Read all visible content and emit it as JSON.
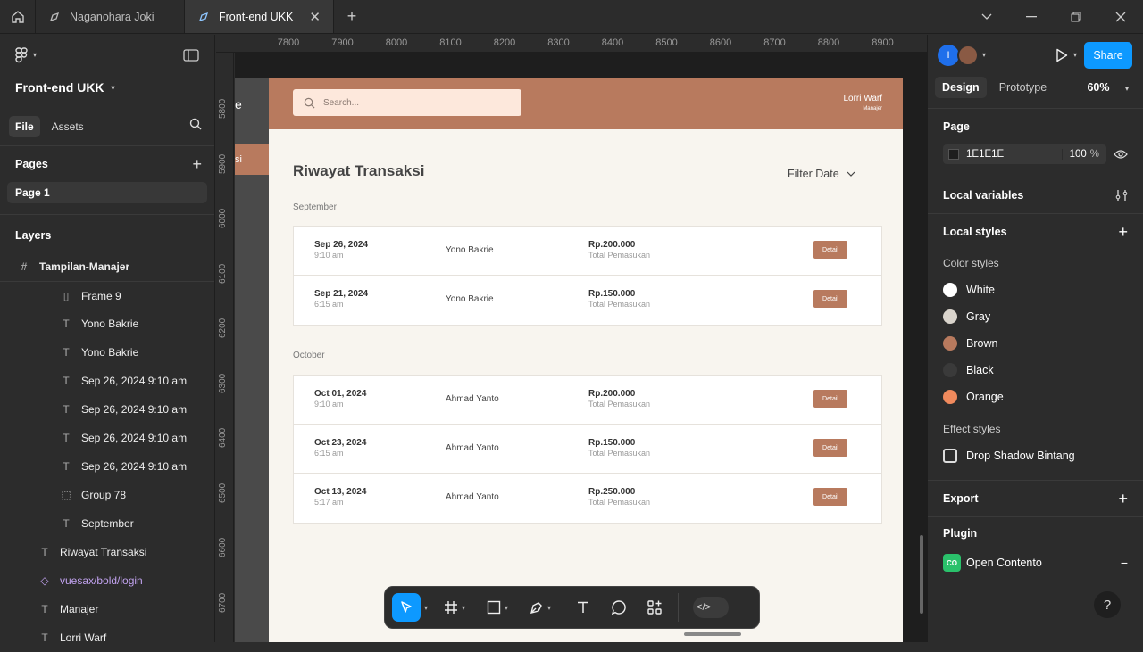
{
  "titlebar": {
    "tabs": [
      {
        "label": "Naganohara Joki"
      },
      {
        "label": "Front-end UKK"
      }
    ]
  },
  "left_panel": {
    "project_name": "Front-end UKK",
    "file_tab": "File",
    "assets_tab": "Assets",
    "pages_heading": "Pages",
    "page_item": "Page 1",
    "layers_heading": "Layers",
    "layers": [
      {
        "label": "Tampilan-Manajer",
        "icon": "frame-icon"
      },
      {
        "label": "Frame 9",
        "icon": "auto-layout-icon"
      },
      {
        "label": "Yono Bakrie",
        "icon": "text-icon"
      },
      {
        "label": "Yono Bakrie",
        "icon": "text-icon"
      },
      {
        "label": "Sep 26, 2024 9:10 am",
        "icon": "text-icon"
      },
      {
        "label": "Sep 26, 2024 9:10 am",
        "icon": "text-icon"
      },
      {
        "label": "Sep 26, 2024 9:10 am",
        "icon": "text-icon"
      },
      {
        "label": "Sep 26, 2024 9:10 am",
        "icon": "text-icon"
      },
      {
        "label": "Group 78",
        "icon": "group-icon"
      },
      {
        "label": "September",
        "icon": "text-icon"
      },
      {
        "label": "Riwayat Transaksi",
        "icon": "text-icon"
      },
      {
        "label": "vuesax/bold/login",
        "icon": "component-icon"
      },
      {
        "label": "Manajer",
        "icon": "text-icon"
      },
      {
        "label": "Lorri Warf",
        "icon": "text-icon"
      }
    ]
  },
  "rulers": {
    "top": [
      "7800",
      "7900",
      "8000",
      "8100",
      "8200",
      "8300",
      "8400",
      "8500",
      "8600",
      "8700",
      "8800",
      "8900"
    ],
    "left": [
      "5800",
      "5900",
      "6000",
      "6100",
      "6200",
      "6300",
      "6400",
      "6500",
      "6600",
      "6700"
    ]
  },
  "canvas": {
    "prev_frame_text_1": "e",
    "prev_frame_text_2": "si",
    "frame": {
      "search_placeholder": "Search...",
      "user_name": "Lorri Warf",
      "user_role": "Manajer",
      "title": "Riwayat Transaksi",
      "filter_label": "Filter Date",
      "sections": [
        {
          "month": "September",
          "rows": [
            {
              "date": "Sep 26, 2024",
              "time": "9:10 am",
              "name": "Yono Bakrie",
              "amount": "Rp.200.000",
              "amount_label": "Total Pemasukan",
              "button": "Detail"
            },
            {
              "date": "Sep 21, 2024",
              "time": "6:15 am",
              "name": "Yono Bakrie",
              "amount": "Rp.150.000",
              "amount_label": "Total Pemasukan",
              "button": "Detail"
            }
          ]
        },
        {
          "month": "October",
          "rows": [
            {
              "date": "Oct 01, 2024",
              "time": "9:10 am",
              "name": "Ahmad Yanto",
              "amount": "Rp.200.000",
              "amount_label": "Total Pemasukan",
              "button": "Detail"
            },
            {
              "date": "Oct 23, 2024",
              "time": "6:15 am",
              "name": "Ahmad Yanto",
              "amount": "Rp.150.000",
              "amount_label": "Total Pemasukan",
              "button": "Detail"
            },
            {
              "date": "Oct 13, 2024",
              "time": "5:17 am",
              "name": "Ahmad Yanto",
              "amount": "Rp.250.000",
              "amount_label": "Total Pemasukan",
              "button": "Detail"
            }
          ]
        }
      ]
    }
  },
  "right_panel": {
    "avatar_initial": "I",
    "share_label": "Share",
    "design_tab": "Design",
    "prototype_tab": "Prototype",
    "zoom": "60%",
    "page_heading": "Page",
    "page_color": "1E1E1E",
    "page_opacity": "100",
    "page_opacity_unit": "%",
    "local_variables": "Local variables",
    "local_styles": "Local styles",
    "color_styles_heading": "Color styles",
    "color_styles": [
      {
        "name": "White",
        "color": "#ffffff"
      },
      {
        "name": "Gray",
        "color": "#d9d4cc"
      },
      {
        "name": "Brown",
        "color": "#b87a5e"
      },
      {
        "name": "Black",
        "color": "#3a3a3a"
      },
      {
        "name": "Orange",
        "color": "#f08a5d"
      }
    ],
    "effect_styles_heading": "Effect styles",
    "effect_style": "Drop Shadow Bintang",
    "export_heading": "Export",
    "plugin_heading": "Plugin",
    "plugin_item": "Open Contento",
    "plugin_icon_text": "CO",
    "help_label": "?"
  },
  "colors": {
    "accent_blue": "#0d99ff",
    "brand_brown": "#b87a5e",
    "frame_bg": "#f8f5ef"
  }
}
